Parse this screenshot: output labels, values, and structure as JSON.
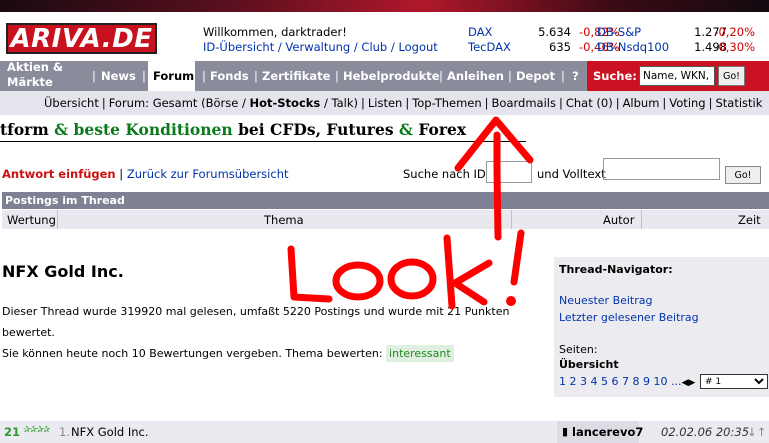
{
  "brand": {
    "logo_text": "ARIVA.DE",
    "accent": "#cc1122"
  },
  "header": {
    "welcome": "Willkommen, darktrader!",
    "links": [
      "ID-Übersicht",
      "Verwaltung",
      "Club",
      "Logout"
    ]
  },
  "quotes": [
    {
      "name": "DAX",
      "value": "5.634",
      "change": "-0,82%",
      "name2": "DB-S&P",
      "value2": "1.277",
      "change2": "-0,20%"
    },
    {
      "name": "TecDAX",
      "value": "635",
      "change": "-0,46%",
      "name2": "DB-Nsdq100",
      "value2": "1.498",
      "change2": "-0,30%"
    }
  ],
  "nav": {
    "items": [
      "Aktien &",
      "Märkte",
      "News",
      "Forum",
      "Fonds",
      "Zertifikate",
      "Hebelprodukte",
      "Anleihen",
      "Depot",
      "?"
    ],
    "search_label": "Suche:",
    "search_placeholder": "Name, WKN, Kü",
    "go": "Go!"
  },
  "subnav": {
    "items": [
      "Übersicht",
      "Forum: Gesamt (Börse /",
      "Hot-Stocks",
      "/ Talk)",
      "Listen",
      "Top-Themen",
      "Boardmails",
      "Chat (0)",
      "Album",
      "Voting",
      "Statistik"
    ]
  },
  "ad": {
    "parts": [
      "tform",
      "&",
      "beste Konditionen",
      "bei CFDs",
      ",",
      "Futures",
      "&",
      "Forex"
    ]
  },
  "actions": {
    "reply": "Antwort einfügen",
    "back": "Zurück zur Forumsübersicht",
    "search_id": "Suche nach ID",
    "fulltext": "und Volltext",
    "go": "Go!"
  },
  "thread": {
    "header": "Postings im Thread",
    "columns": [
      "Wertung",
      "Thema",
      "Autor",
      "Zeit"
    ],
    "title": "NFX Gold Inc.",
    "desc1": "Dieser Thread wurde 319920 mal gelesen, umfaßt 5220 Postings und wurde mit 21 Punkten bewertet.",
    "desc2": "Sie können heute noch 10 Bewertungen vergeben. Thema bewerten:",
    "rate_label": "interessant"
  },
  "navigator": {
    "title": "Thread-Navigator:",
    "newest": "Neuester Beitrag",
    "last_read": "Letzter gelesener Beitrag",
    "pages_label": "Seiten:",
    "overview": "Übersicht",
    "pages": "1 2 3 4 5 6 7 8 9 10 ...",
    "arrows": "◀▶",
    "select_value": "# 1"
  },
  "post": {
    "score": "21",
    "stars": "✰✰✰✰",
    "number": "1.",
    "title": "NFX Gold Inc.",
    "author": "lancerevo7",
    "date": "02.02.06 20:35",
    "arrows": "↓↑"
  },
  "annotation": {
    "text": "Look !",
    "color": "#ff0000"
  }
}
